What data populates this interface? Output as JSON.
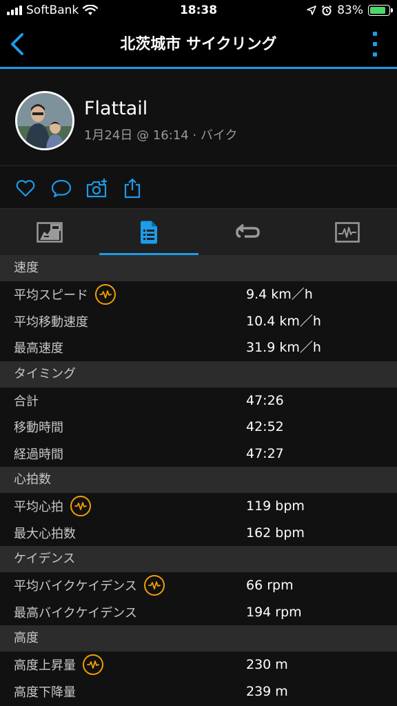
{
  "status_bar": {
    "carrier": "SoftBank",
    "time": "18:38",
    "battery_percent": "83%",
    "battery_level": 0.83
  },
  "nav": {
    "title": "北茨城市 サイクリング"
  },
  "profile": {
    "name": "Flattail",
    "meta": "1月24日 @ 16:14 · バイク"
  },
  "actions": [
    "heart-icon",
    "comment-icon",
    "camera-add-icon",
    "share-icon"
  ],
  "tabs": [
    {
      "icon": "overview-chart-icon",
      "active": false
    },
    {
      "icon": "stats-list-icon",
      "active": true
    },
    {
      "icon": "laps-icon",
      "active": false
    },
    {
      "icon": "graph-icon",
      "active": false
    }
  ],
  "colors": {
    "accent": "#1e9be8",
    "badge": "#f29f05",
    "section_bg": "#2c2c2c",
    "background": "#111111"
  },
  "sections": [
    {
      "title": "速度",
      "rows": [
        {
          "label": "平均スピード",
          "value": "9.4 km／h",
          "chart_badge": true
        },
        {
          "label": "平均移動速度",
          "value": "10.4 km／h",
          "chart_badge": false
        },
        {
          "label": "最高速度",
          "value": "31.9 km／h",
          "chart_badge": false
        }
      ]
    },
    {
      "title": "タイミング",
      "rows": [
        {
          "label": "合計",
          "value": "47:26",
          "chart_badge": false
        },
        {
          "label": "移動時間",
          "value": "42:52",
          "chart_badge": false
        },
        {
          "label": "経過時間",
          "value": "47:27",
          "chart_badge": false
        }
      ]
    },
    {
      "title": "心拍数",
      "rows": [
        {
          "label": "平均心拍",
          "value": "119 bpm",
          "chart_badge": true
        },
        {
          "label": "最大心拍数",
          "value": "162 bpm",
          "chart_badge": false
        }
      ]
    },
    {
      "title": "ケイデンス",
      "rows": [
        {
          "label": "平均バイクケイデンス",
          "value": "66 rpm",
          "chart_badge": true
        },
        {
          "label": "最高バイクケイデンス",
          "value": "194 rpm",
          "chart_badge": false
        }
      ]
    },
    {
      "title": "高度",
      "rows": [
        {
          "label": "高度上昇量",
          "value": "230 m",
          "chart_badge": true
        },
        {
          "label": "高度下降量",
          "value": "239 m",
          "chart_badge": false
        }
      ]
    }
  ]
}
